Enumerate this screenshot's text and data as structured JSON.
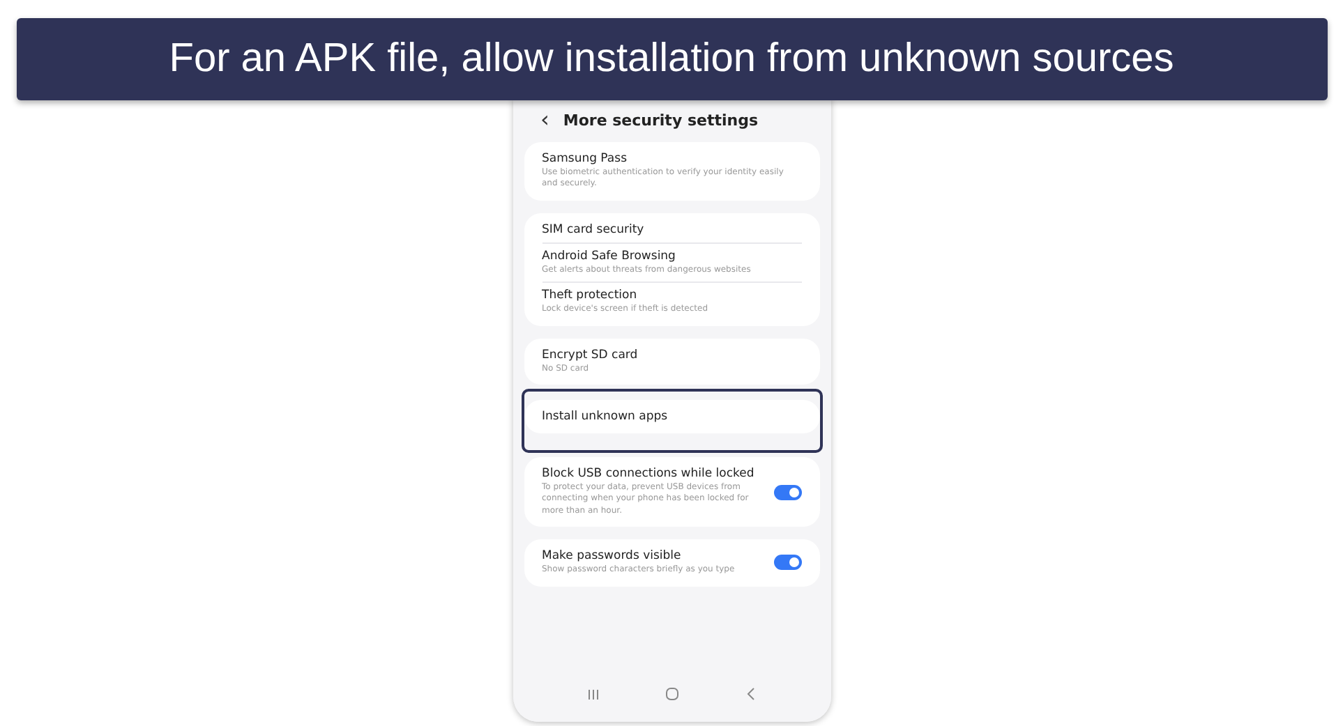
{
  "banner": {
    "text": "For an APK file, allow installation from unknown sources"
  },
  "header": {
    "back_icon": "‹",
    "title": "More security settings"
  },
  "groups": [
    {
      "highlighted": false,
      "items": [
        {
          "title": "Samsung Pass",
          "subtitle": "Use biometric authentication to verify your identity easily and securely."
        }
      ]
    },
    {
      "highlighted": false,
      "items": [
        {
          "title": "SIM card security"
        },
        {
          "title": "Android Safe Browsing",
          "subtitle": "Get alerts about threats from dangerous websites"
        },
        {
          "title": "Theft protection",
          "subtitle": "Lock device's screen if theft is detected"
        }
      ]
    },
    {
      "highlighted": false,
      "items": [
        {
          "title": "Encrypt SD card",
          "subtitle": "No SD card"
        }
      ]
    },
    {
      "highlighted": true,
      "items": [
        {
          "title": "Install unknown apps"
        }
      ]
    },
    {
      "highlighted": false,
      "items": [
        {
          "title": "Block USB connections while locked",
          "subtitle": "To protect your data, prevent USB devices from connecting when your phone has been locked for more than an hour.",
          "on": true
        }
      ]
    },
    {
      "highlighted": false,
      "items": [
        {
          "title": "Make passwords visible",
          "subtitle": "Show password characters briefly as you type",
          "on": true
        }
      ]
    }
  ]
}
